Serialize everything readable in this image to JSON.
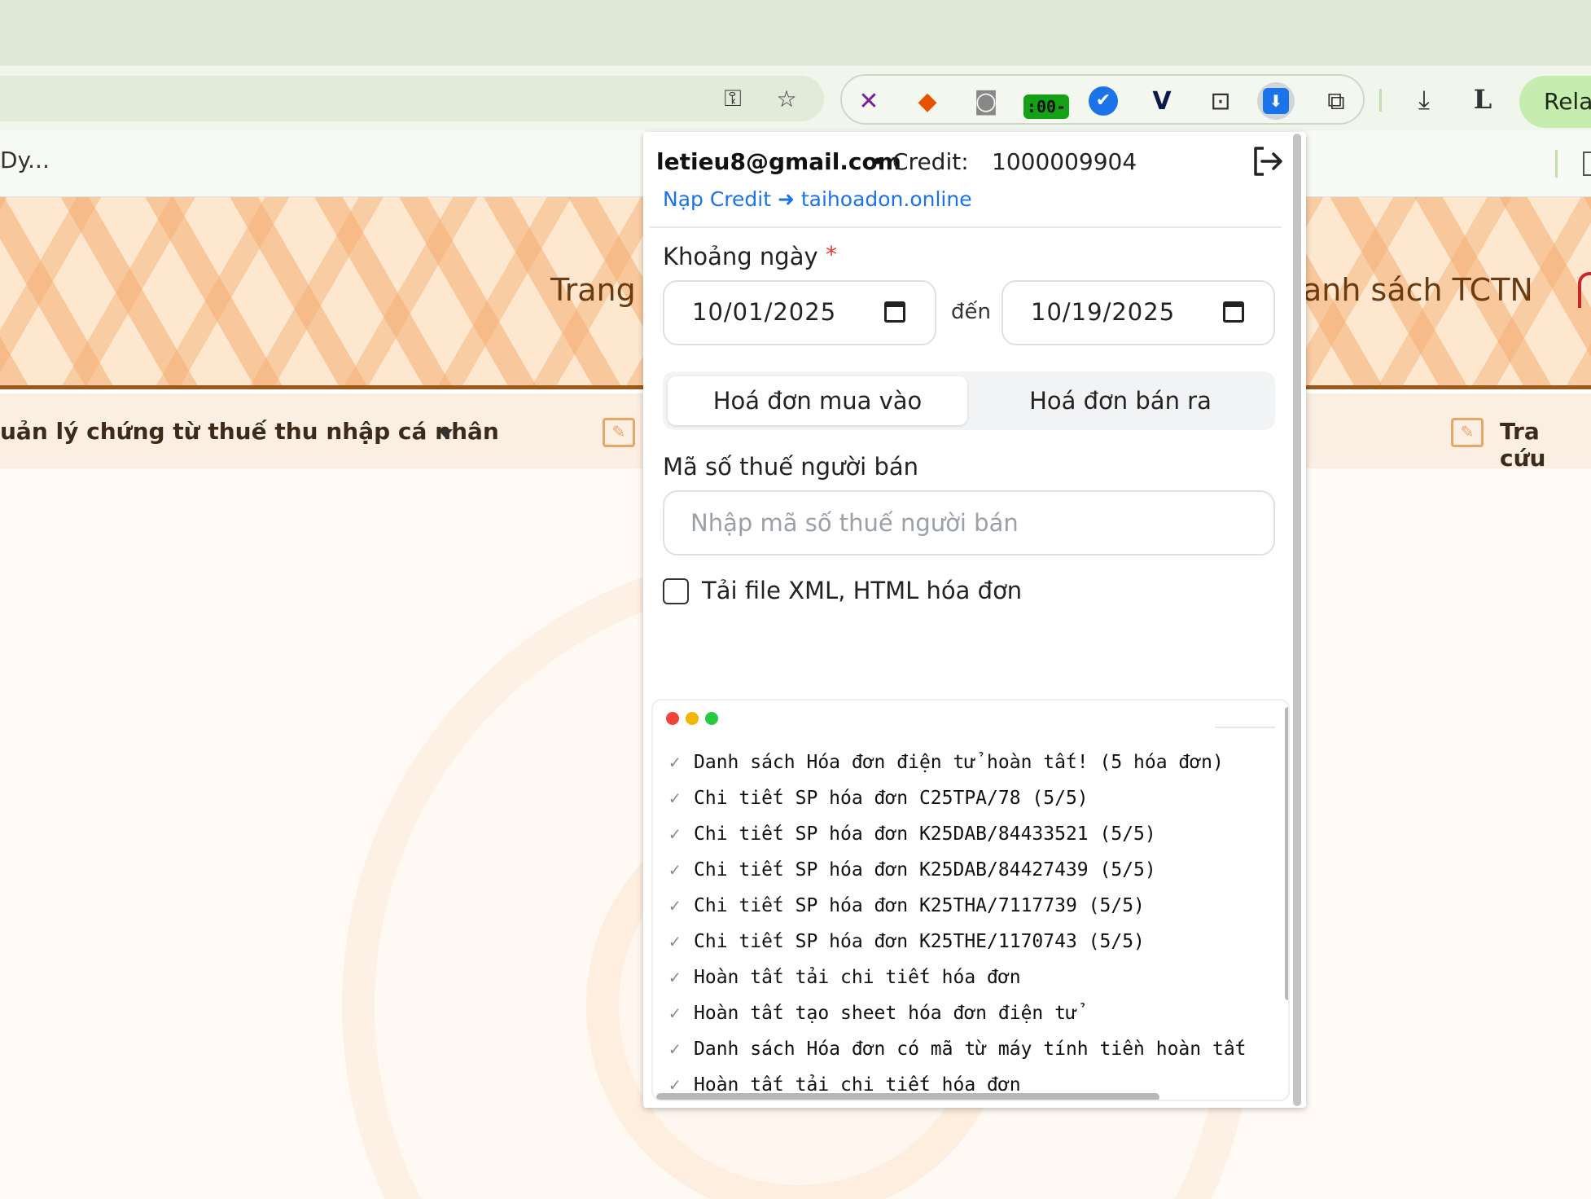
{
  "browser": {
    "bookmark_text": "Dy...",
    "relaunch_label": "Rela",
    "extensions": [
      {
        "icon": "x-logo-icon",
        "glyph": "✕",
        "color": "#7b1fa2"
      },
      {
        "icon": "fox-icon",
        "glyph": "🦊",
        "color": "#e65100"
      },
      {
        "icon": "camera-icon",
        "glyph": "📷",
        "color": "#777777"
      },
      {
        "icon": "badge-icon",
        "badge": ":00-",
        "color": "#15a115"
      },
      {
        "icon": "v-check-icon",
        "glyph": "✔",
        "color": "#1a73e8"
      },
      {
        "icon": "v-logo-icon",
        "glyph": "V",
        "color": "#0b1a4a"
      },
      {
        "icon": "robot-icon",
        "glyph": "⌂",
        "color": "#333333"
      },
      {
        "icon": "download-ext-icon",
        "glyph": "⬇",
        "color": "#1a73e8"
      },
      {
        "icon": "puzzle-icon",
        "glyph": "⧉",
        "color": "#333333"
      }
    ]
  },
  "page": {
    "nav_home": "Trang",
    "nav_list": "anh sách TCTN",
    "menu_left": "uản lý chứng từ thuế thu nhập cá nhân",
    "menu_lookup": "Tra cứu"
  },
  "popup": {
    "email": "letieu8@gmail.com",
    "separator": "•",
    "credit_label": "Credit:",
    "credit_value": "1000009904",
    "topup_link": "Nạp Credit ➜ taihoadon.online",
    "range_label": "Khoảng ngày",
    "required_mark": "*",
    "date_from": "10/01/2025",
    "date_to_label": "đến",
    "date_to": "10/19/2025",
    "tabs": {
      "buy": "Hoá đơn mua vào",
      "sell": "Hoá đơn bán ra"
    },
    "tax_label": "Mã số thuế người bán",
    "tax_placeholder": "Nhập mã số thuế người bán",
    "xml_label": "Tải file XML, HTML hóa đơn",
    "log": [
      "Danh sách Hóa đơn điện tử hoàn tất! (5 hóa đơn)",
      "Chi tiết SP hóa đơn C25TPA/78 (5/5)",
      "Chi tiết SP hóa đơn K25DAB/84433521 (5/5)",
      "Chi tiết SP hóa đơn K25DAB/84427439 (5/5)",
      "Chi tiết SP hóa đơn K25THA/7117739 (5/5)",
      "Chi tiết SP hóa đơn K25THE/1170743 (5/5)",
      "Hoàn tất tải chi tiết hóa đơn",
      "Hoàn tất tạo sheet hóa đơn điện tử",
      "Danh sách Hóa đơn có mã từ máy tính tiền hoàn tất",
      "Hoàn tất tải chi tiết hóa đơn"
    ],
    "check_glyph": "✓"
  }
}
